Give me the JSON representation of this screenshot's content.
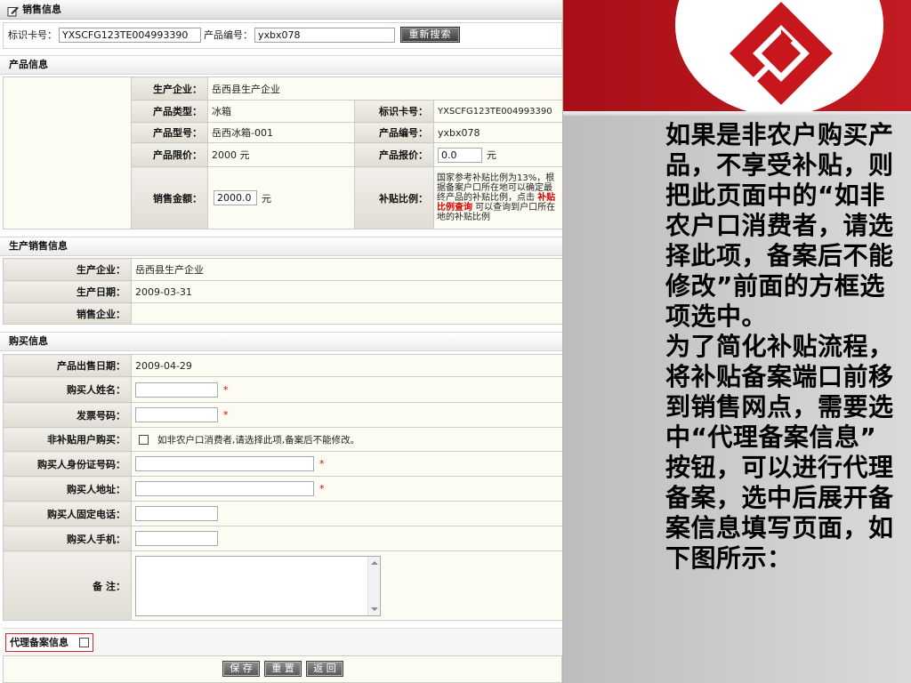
{
  "form": {
    "title": "销售信息",
    "search": {
      "card_label": "标识卡号：",
      "card_value": "YXSCFG123TE004993390",
      "code_label": "产品编号：",
      "code_value": "yxbx078",
      "search_button": "重新搜索"
    },
    "product": {
      "heading": "产品信息",
      "maker_label": "生产企业：",
      "maker": "岳西县生产企业",
      "type_label": "产品类型：",
      "type": "冰箱",
      "card_label": "标识卡号：",
      "card": "YXSCFG123TE004993390",
      "model_label": "产品型号：",
      "model": "岳西冰箱-001",
      "code_label": "产品编号：",
      "code": "yxbx078",
      "limit_label": "产品限价：",
      "limit": "2000 元",
      "quote_label": "产品报价：",
      "quote": "0.0",
      "quote_unit": "元",
      "amount_label": "销售金额：",
      "amount": "2000.0",
      "amount_unit": "元",
      "subsidy_label": "补贴比例：",
      "subsidy_text_before": "国家参考补贴比例为13%，根据备案户口所在地可以确定最终产品的补贴比例，点击 ",
      "subsidy_link": "补贴比例查询",
      "subsidy_text_after": " 可以查询到户口所在地的补贴比例"
    },
    "production": {
      "heading": "生产销售信息",
      "rows": [
        {
          "label": "生产企业：",
          "value": "岳西县生产企业"
        },
        {
          "label": "生产日期：",
          "value": "2009-03-31"
        },
        {
          "label": "销售企业：",
          "value": ""
        }
      ]
    },
    "purchase": {
      "heading": "购买信息",
      "required_mark": "*",
      "sale_date_label": "产品出售日期：",
      "sale_date": "2009-04-29",
      "buyer_name_label": "购买人姓名：",
      "buyer_name": "",
      "invoice_label": "发票号码：",
      "invoice": "",
      "non_subsidy_label": "非补贴用户购买：",
      "non_subsidy_checked": false,
      "non_subsidy_hint": "如非农户口消费者,请选择此项,备案后不能修改。",
      "id_label": "购买人身份证号码：",
      "id_number": "",
      "address_label": "购买人地址：",
      "address": "",
      "phone_label": "购买人固定电话：",
      "phone": "",
      "mobile_label": "购买人手机：",
      "mobile": "",
      "remarks_label": "备 注：",
      "remarks": ""
    },
    "agent": {
      "label": "代理备案信息",
      "checked": false
    },
    "buttons": {
      "save": "保 存",
      "reset": "重 置",
      "back": "返 回"
    }
  },
  "side_text": {
    "lines": [
      "如果是非农户购买产",
      "品，不享受补贴，则",
      "把此页面中的“如非",
      "农户口消费者，请选",
      "择此项，备案后不能",
      "修改”前面的方框选",
      "项选中。",
      "为了简化补贴流程，",
      "将补贴备案端口前移",
      "到销售网点，需要选",
      "中“代理备案信息”",
      "按钮，可以进行代理",
      "备案，选中后展开备",
      "案信息填写页面，如",
      "下图所示："
    ]
  },
  "colors": {
    "brand_red": "#c8161d",
    "required_red": "#e00000",
    "highlight_border": "#d9262c",
    "label_cell": "#e6e3da",
    "value_cell": "#fdfcf2",
    "panel_grey": "#cccccc"
  }
}
